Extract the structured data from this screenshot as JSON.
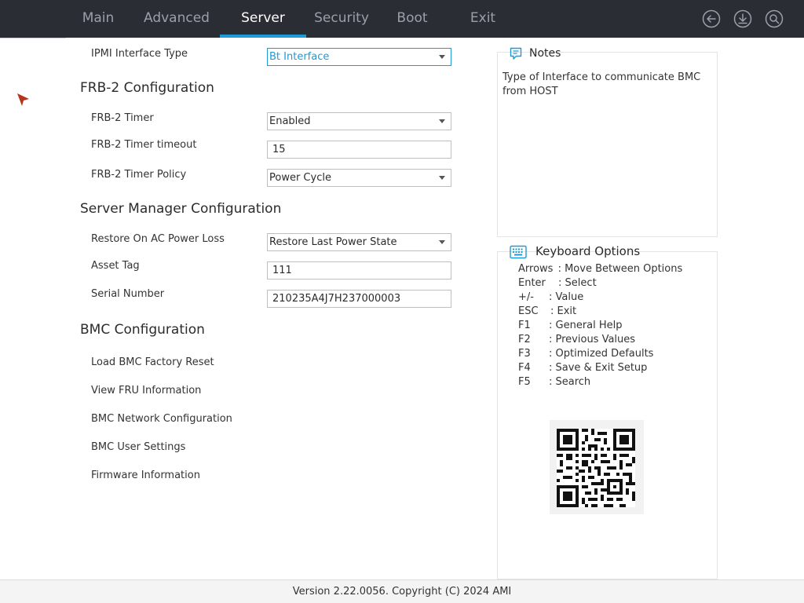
{
  "nav": {
    "tabs": [
      {
        "label": "Main"
      },
      {
        "label": "Advanced"
      },
      {
        "label": "Server"
      },
      {
        "label": "Security"
      },
      {
        "label": "Boot"
      },
      {
        "label": "Exit"
      }
    ],
    "active_tab": "Server",
    "accent_color": "#1e9ad6",
    "icons": [
      "back-arrow-icon",
      "save-download-icon",
      "search-icon"
    ]
  },
  "settings": {
    "ipmi_interface_type": {
      "label": "IPMI Interface Type",
      "value": "Bt Interface"
    },
    "frb2_section": "FRB-2 Configuration",
    "frb2_timer": {
      "label": "FRB-2 Timer",
      "value": "Enabled"
    },
    "frb2_timeout": {
      "label": "FRB-2 Timer timeout",
      "value": "15"
    },
    "frb2_policy": {
      "label": "FRB-2 Timer Policy",
      "value": "Power Cycle"
    },
    "server_manager_section": "Server Manager Configuration",
    "restore_ac": {
      "label": "Restore On AC Power Loss",
      "value": "Restore Last Power State"
    },
    "asset_tag": {
      "label": "Asset Tag",
      "value": "111"
    },
    "serial_number": {
      "label": "Serial Number",
      "value": "210235A4J7H237000003"
    },
    "bmc_section": "BMC Configuration",
    "bmc_items": [
      {
        "label": "Load BMC Factory Reset"
      },
      {
        "label": "View FRU Information"
      },
      {
        "label": "BMC Network Configuration"
      },
      {
        "label": "BMC User Settings"
      },
      {
        "label": "Firmware Information"
      }
    ]
  },
  "notes": {
    "title": "Notes",
    "text": "Type of Interface to communicate BMC from HOST"
  },
  "keyboard": {
    "title": "Keyboard Options",
    "rows": [
      {
        "key": "Arrows",
        "desc": ": Move Between Options"
      },
      {
        "key": "Enter",
        "desc": ": Select"
      },
      {
        "key": "+/-",
        "desc": ": Value"
      },
      {
        "key": "ESC",
        "desc": ": Exit"
      },
      {
        "key": "F1",
        "desc": ": General Help"
      },
      {
        "key": "F2",
        "desc": ": Previous Values"
      },
      {
        "key": "F3",
        "desc": ": Optimized Defaults"
      },
      {
        "key": "F4",
        "desc": ": Save & Exit Setup"
      },
      {
        "key": "F5",
        "desc": ": Search"
      }
    ]
  },
  "footer": {
    "version": "Version 2.22.0056. Copyright (C) 2024 AMI"
  }
}
